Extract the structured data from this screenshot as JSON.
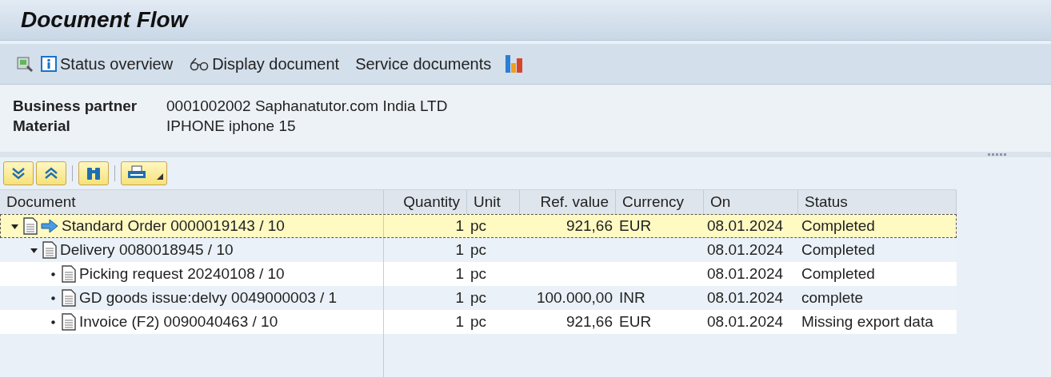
{
  "window": {
    "title": "Document Flow"
  },
  "toolbar": [
    {
      "kind": "info",
      "label": "Status overview"
    },
    {
      "kind": "glasses",
      "label": "Display document"
    },
    {
      "kind": "plain",
      "label": "Service documents"
    }
  ],
  "header": [
    {
      "label": "Business partner",
      "value": "0001002002 Saphanatutor.com India LTD"
    },
    {
      "label": "Material",
      "value": "IPHONE iphone 15"
    }
  ],
  "columns": [
    "Document",
    "Quantity",
    "Unit",
    "Ref. value",
    "Currency",
    "On",
    "Status"
  ],
  "rows": [
    {
      "document": "Standard Order 0000019143 / 10",
      "quantity": "1",
      "unit": "pc",
      "ref_value": "921,66",
      "currency": "EUR",
      "on": "08.01.2024",
      "status": "Completed",
      "selected": true,
      "current": true,
      "expanded": true,
      "children": [
        {
          "document": "Delivery 0080018945 / 10",
          "quantity": "1",
          "unit": "pc",
          "on": "08.01.2024",
          "status": "Completed",
          "selected": false,
          "current": false,
          "expanded": true,
          "children": [
            {
              "document": "Picking request 20240108 / 10",
              "quantity": "1",
              "unit": "pc",
              "on": "08.01.2024",
              "status": "Completed",
              "selected": false,
              "current": false
            },
            {
              "document": "GD goods issue:delvy 0049000003 / 1",
              "quantity": "1",
              "unit": "pc",
              "ref_value": "100.000,00",
              "currency": "INR",
              "on": "08.01.2024",
              "status": "complete",
              "selected": false,
              "current": false
            },
            {
              "document": "Invoice (F2) 0090040463 / 10",
              "quantity": "1",
              "unit": "pc",
              "ref_value": "921,66",
              "currency": "EUR",
              "on": "08.01.2024",
              "status": "Missing export data",
              "selected": false,
              "current": false
            }
          ]
        }
      ]
    }
  ]
}
